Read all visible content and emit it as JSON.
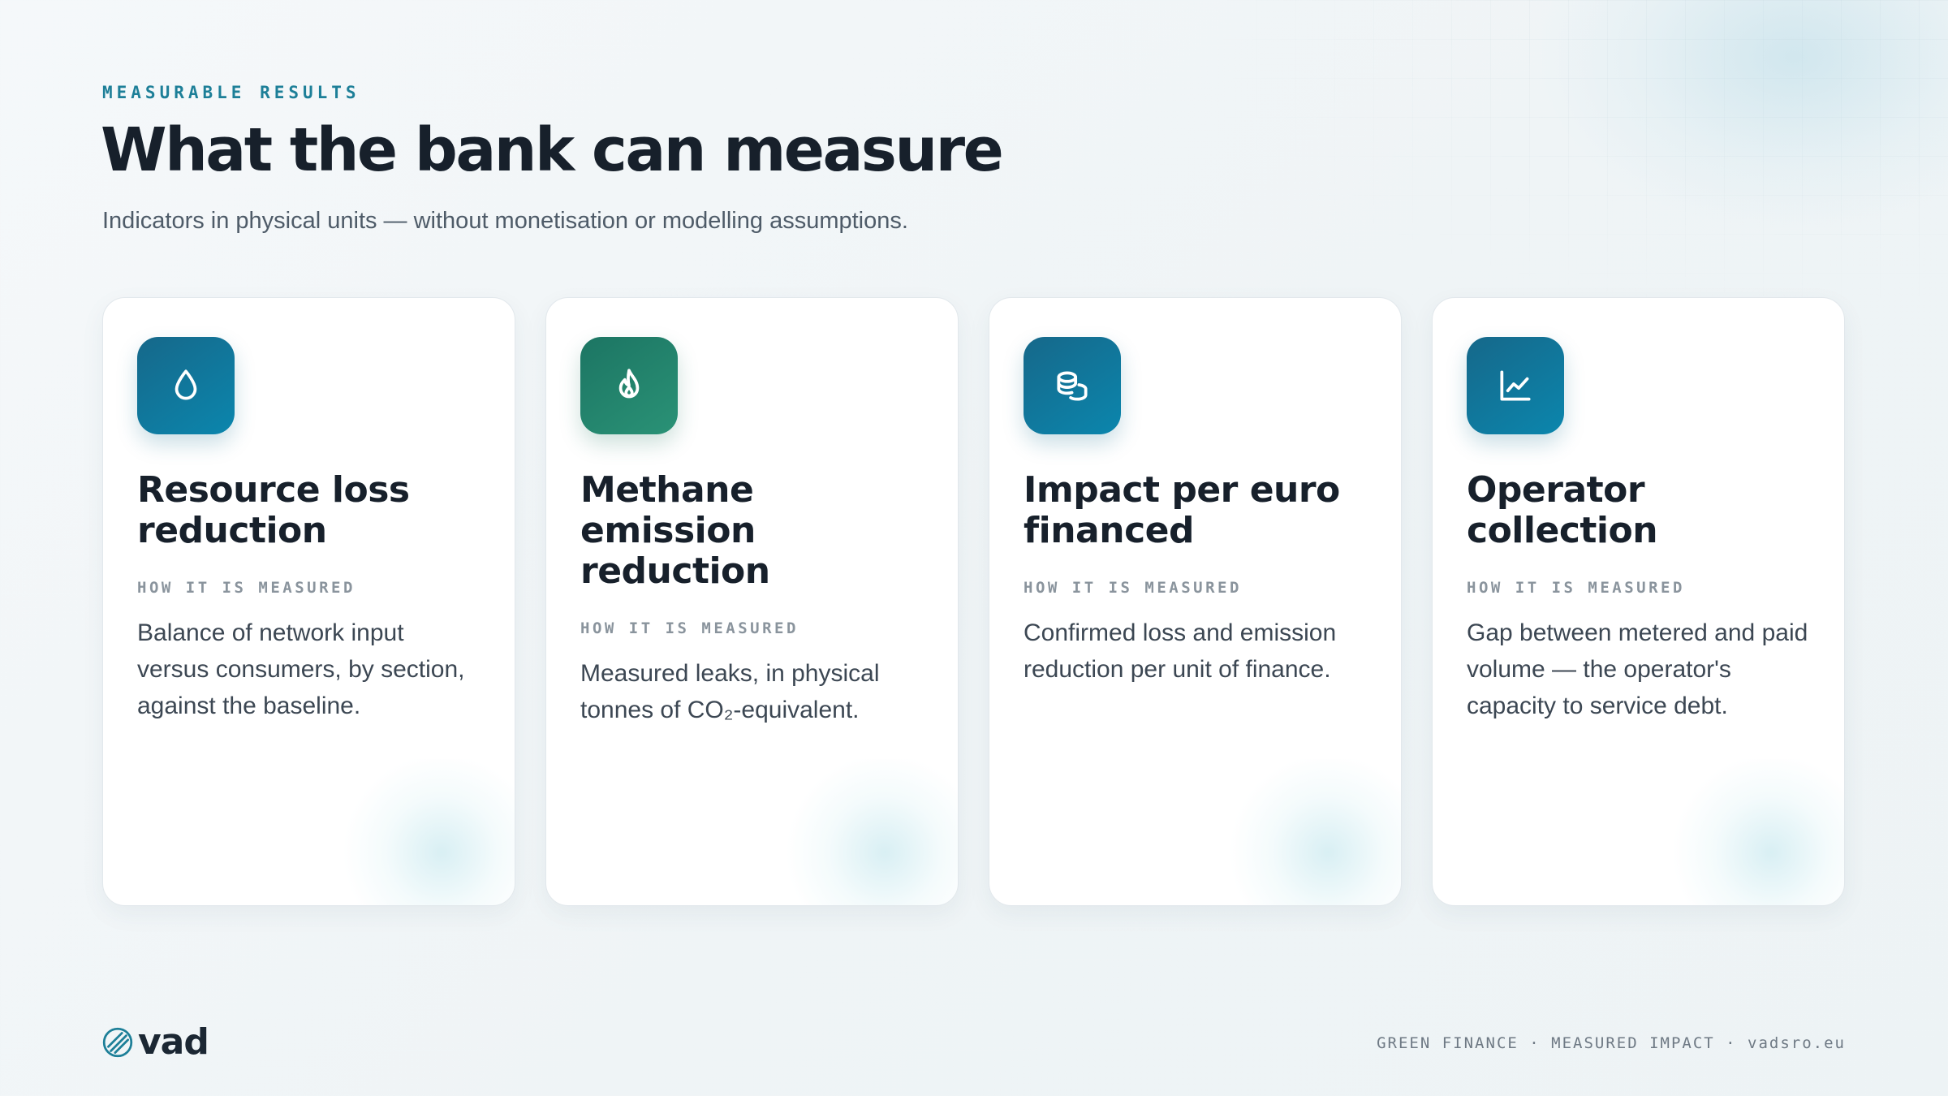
{
  "header": {
    "eyebrow": "MEASURABLE RESULTS",
    "title": "What the bank can measure",
    "subtitle": "Indicators in physical units — without monetisation or modelling assumptions."
  },
  "colors": {
    "accent": "#1d7f98",
    "tile_blue": "#0b86ad",
    "tile_green": "#2a9276",
    "heading": "#17202b"
  },
  "cards": [
    {
      "icon": "water-drop-icon",
      "title": "Resource loss reduction",
      "measure_label": "HOW IT IS MEASURED",
      "description": "Balance of network input versus consumers, by section, against the baseline."
    },
    {
      "icon": "flame-icon",
      "title": "Methane emission reduction",
      "measure_label": "HOW IT IS MEASURED",
      "description": "Measured leaks, in physical tonnes of CO₂-equivalent."
    },
    {
      "icon": "coins-icon",
      "title": "Impact per euro financed",
      "measure_label": "HOW IT IS MEASURED",
      "description": "Confirmed loss and emission reduction per unit of finance."
    },
    {
      "icon": "line-chart-icon",
      "title": "Operator collection",
      "measure_label": "HOW IT IS MEASURED",
      "description": "Gap between metered and paid volume — the operator's capacity to service debt."
    }
  ],
  "footer": {
    "logo_text": "vad",
    "right_text": "GREEN FINANCE · MEASURED IMPACT · vadsro.eu"
  }
}
